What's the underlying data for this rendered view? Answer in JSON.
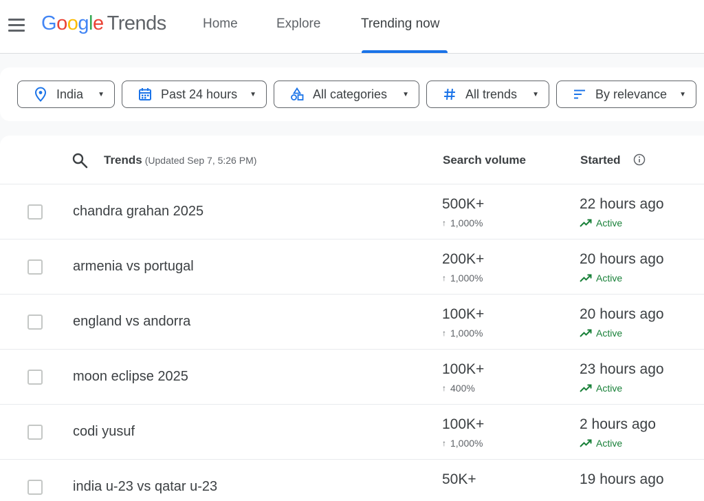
{
  "header": {
    "logo_google": [
      "G",
      "o",
      "o",
      "g",
      "l",
      "e"
    ],
    "logo_trends": "Trends",
    "nav": {
      "home": "Home",
      "explore": "Explore",
      "trending_now": "Trending now"
    },
    "active_tab": "trending_now"
  },
  "filters": {
    "location": "India",
    "time_range": "Past 24 hours",
    "category": "All categories",
    "trend_status": "All trends",
    "sort": "By relevance"
  },
  "table": {
    "headers": {
      "trends": "Trends",
      "updated": "(Updated Sep 7, 5:26 PM)",
      "search_volume": "Search volume",
      "started": "Started"
    },
    "rows": [
      {
        "term": "chandra grahan 2025",
        "volume": "500K+",
        "increase": "1,000%",
        "started": "22 hours ago",
        "status": "Active"
      },
      {
        "term": "armenia vs portugal",
        "volume": "200K+",
        "increase": "1,000%",
        "started": "20 hours ago",
        "status": "Active"
      },
      {
        "term": "england vs andorra",
        "volume": "100K+",
        "increase": "1,000%",
        "started": "20 hours ago",
        "status": "Active"
      },
      {
        "term": "moon eclipse 2025",
        "volume": "100K+",
        "increase": "400%",
        "started": "23 hours ago",
        "status": "Active"
      },
      {
        "term": "codi yusuf",
        "volume": "100K+",
        "increase": "1,000%",
        "started": "2 hours ago",
        "status": "Active"
      },
      {
        "term": "india u-23 vs qatar u-23",
        "volume": "50K+",
        "started": "19 hours ago"
      }
    ]
  },
  "colors": {
    "accent": "#1a73e8",
    "active_green": "#188038",
    "text": "#3c4043",
    "muted": "#5f6368"
  },
  "icons": {
    "menu": "hamburger-menu-icon",
    "location": "location-pin-icon",
    "calendar": "calendar-icon",
    "category": "category-shapes-icon",
    "hashtag": "hashtag-icon",
    "sort": "sort-lines-icon",
    "search": "search-icon",
    "info": "info-icon",
    "trending": "trending-up-icon"
  }
}
